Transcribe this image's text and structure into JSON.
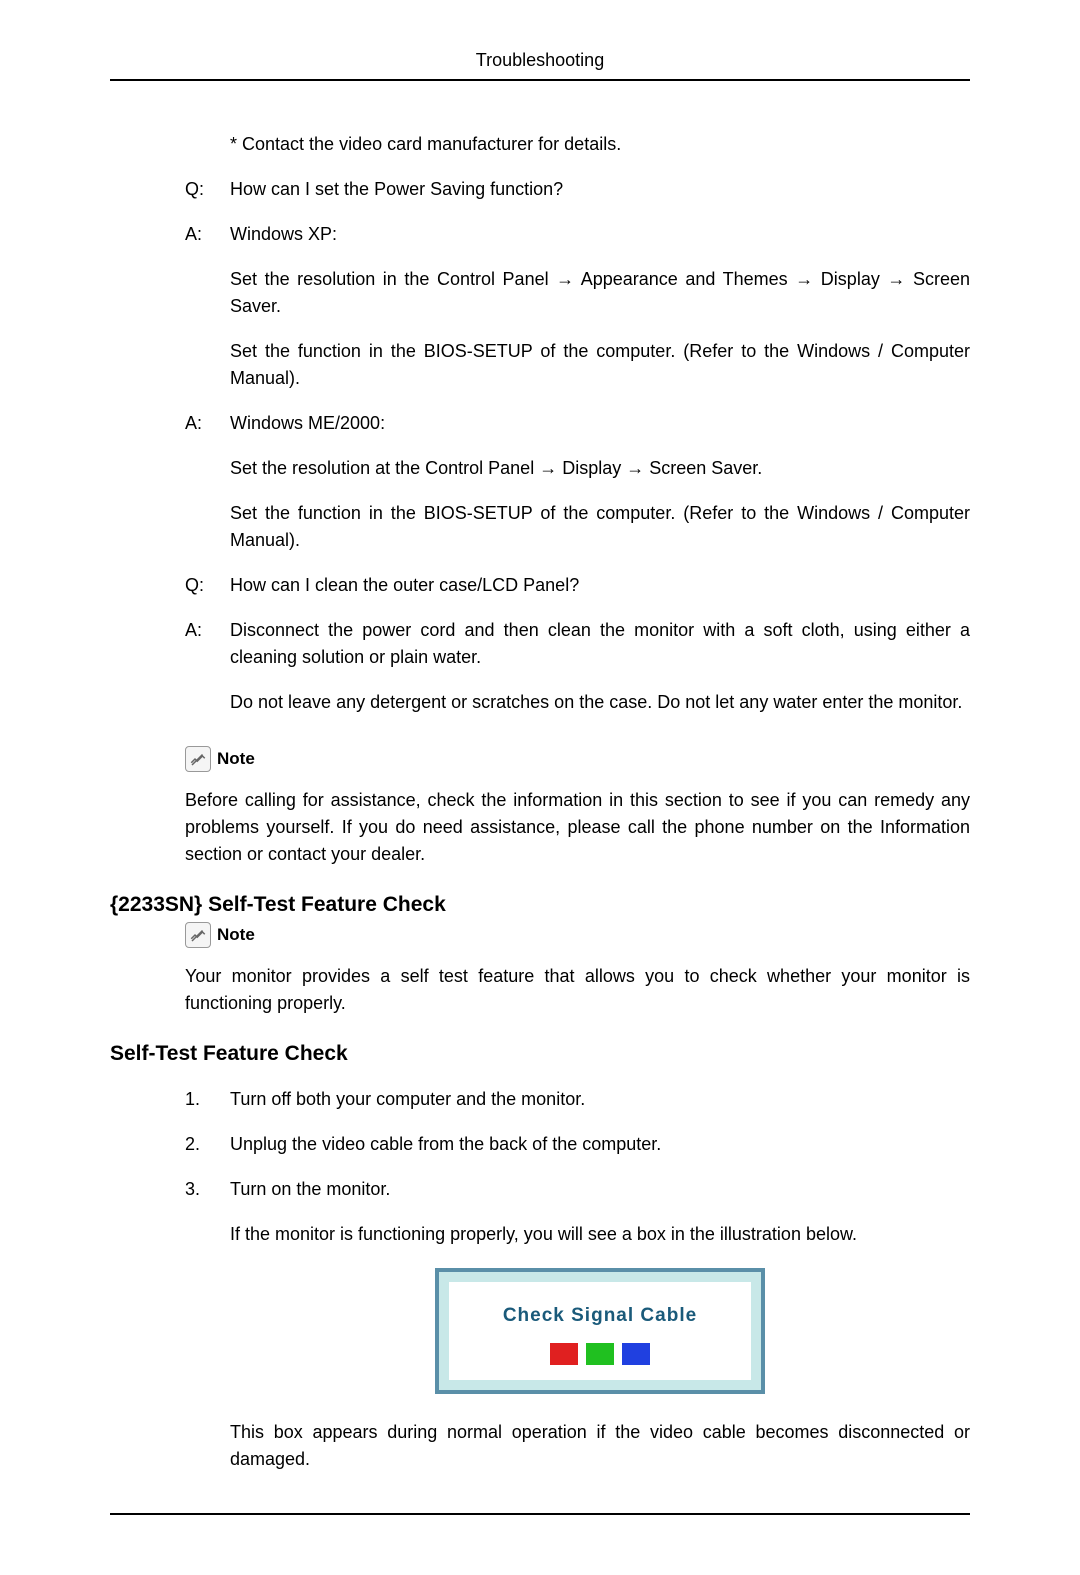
{
  "header": {
    "title": "Troubleshooting"
  },
  "qa": [
    {
      "label": "",
      "paras": [
        "* Contact the video card manufacturer for details."
      ]
    },
    {
      "label": "Q:",
      "paras": [
        "How can I set the Power Saving function?"
      ]
    },
    {
      "label": "A:",
      "paras": [
        "Windows XP:",
        "Set the resolution in the Control Panel → Appearance and Themes → Display → Screen Saver.",
        "Set the function in the BIOS-SETUP of the computer. (Refer to the Windows / Computer Manual)."
      ]
    },
    {
      "label": "A:",
      "paras": [
        "Windows ME/2000:",
        "Set the resolution at the Control Panel → Display → Screen Saver.",
        "Set the function in the BIOS-SETUP of the computer. (Refer to the Windows / Computer Manual)."
      ]
    },
    {
      "label": "Q:",
      "paras": [
        "How can I clean the outer case/LCD Panel?"
      ]
    },
    {
      "label": "A:",
      "paras": [
        "Disconnect the power cord and then clean the monitor with a soft cloth, using either a cleaning solution or plain water.",
        "Do not leave any detergent or scratches on the case. Do not let any water enter the monitor."
      ]
    }
  ],
  "note1": {
    "label": "Note",
    "text": "Before calling for assistance, check the information in this section to see if you can remedy any problems yourself. If you do need assistance, please call the phone number on the Information section or contact your dealer."
  },
  "section1": {
    "heading": "{2233SN} Self-Test Feature Check"
  },
  "note2": {
    "label": "Note",
    "text": "Your monitor provides a self test feature that allows you to check whether your monitor is functioning properly."
  },
  "section2": {
    "heading": "Self-Test Feature Check"
  },
  "steps": [
    {
      "num": "1.",
      "paras": [
        "Turn off both your computer and the monitor."
      ]
    },
    {
      "num": "2.",
      "paras": [
        "Unplug the video cable from the back of the computer."
      ]
    },
    {
      "num": "3.",
      "paras": [
        "Turn on the monitor.",
        "If the monitor is functioning properly, you will see a box in the illustration below."
      ]
    }
  ],
  "signal": {
    "text": "Check Signal Cable"
  },
  "after_signal": "This box appears during normal operation if the video cable becomes disconnected or damaged."
}
